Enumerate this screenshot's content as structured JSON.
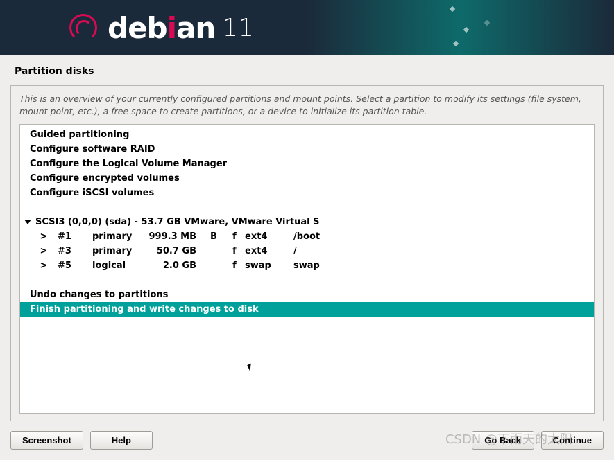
{
  "logo": {
    "brand_a": "deb",
    "brand_b": "i",
    "brand_c": "an",
    "version": "11"
  },
  "page_title": "Partition disks",
  "intro": "This is an overview of your currently configured partitions and mount points. Select a partition to modify its settings (file system, mount point, etc.), a free space to create partitions, or a device to initialize its partition table.",
  "menu": {
    "guided": "Guided partitioning",
    "raid": "Configure software RAID",
    "lvm": "Configure the Logical Volume Manager",
    "encrypted": "Configure encrypted volumes",
    "iscsi": "Configure iSCSI volumes"
  },
  "disk": {
    "label": "SCSI3 (0,0,0) (sda) - 53.7 GB VMware, VMware Virtual S"
  },
  "partitions": [
    {
      "arrow": ">",
      "num": "#1",
      "type": "primary",
      "size": "999.3 MB",
      "flag": "B",
      "fmt": "f",
      "fs": "ext4",
      "mount": "/boot"
    },
    {
      "arrow": ">",
      "num": "#3",
      "type": "primary",
      "size": "50.7 GB",
      "flag": "",
      "fmt": "f",
      "fs": "ext4",
      "mount": "/"
    },
    {
      "arrow": ">",
      "num": "#5",
      "type": "logical",
      "size": "2.0 GB",
      "flag": "",
      "fmt": "f",
      "fs": "swap",
      "mount": "swap"
    }
  ],
  "actions": {
    "undo": "Undo changes to partitions",
    "finish": "Finish partitioning and write changes to disk"
  },
  "buttons": {
    "screenshot": "Screenshot",
    "help": "Help",
    "back": "Go Back",
    "continue": "Continue"
  },
  "watermark": "CSDN @下雨天的太阳"
}
